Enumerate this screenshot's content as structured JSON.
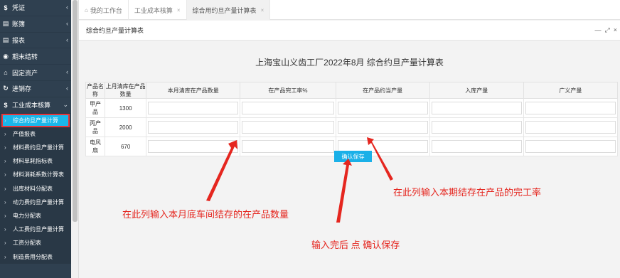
{
  "sidebar": {
    "items": [
      {
        "icon": "$",
        "label": "凭证",
        "chev": "‹"
      },
      {
        "icon": "▤",
        "label": "账簿",
        "chev": "‹"
      },
      {
        "icon": "▤",
        "label": "报表",
        "chev": "‹"
      },
      {
        "icon": "◉",
        "label": "期末结转",
        "chev": ""
      },
      {
        "icon": "⌂",
        "label": "固定资产",
        "chev": "‹"
      },
      {
        "icon": "↻",
        "label": "进销存",
        "chev": "‹"
      },
      {
        "icon": "$",
        "label": "工业成本核算",
        "chev": "⌄"
      }
    ],
    "subitems": [
      {
        "label": "综合约旦产量计算",
        "active": true
      },
      {
        "label": "产值报表"
      },
      {
        "label": "材料费约旦产量计算"
      },
      {
        "label": "材料单耗指标表"
      },
      {
        "label": "材料消耗系数计算表"
      },
      {
        "label": "出库材料分配表"
      },
      {
        "label": "动力费约旦产量计算"
      },
      {
        "label": "电力分配表"
      },
      {
        "label": "人工费约旦产量计算"
      },
      {
        "label": "工资分配表"
      },
      {
        "label": "制造费用分配表"
      }
    ]
  },
  "tabs": [
    {
      "label": "我的工作台",
      "home": true,
      "close": ""
    },
    {
      "label": "工业成本核算",
      "close": "×"
    },
    {
      "label": "综合用约旦产量计算表",
      "close": "×",
      "active": true
    }
  ],
  "panel": {
    "title": "综合约旦产量计算表",
    "tools": [
      "—",
      "⤢",
      "×"
    ]
  },
  "report": {
    "title": "上海宝山义齿工厂2022年8月 综合约旦产量计算表",
    "columns": [
      "产品名称",
      "上月清库在产品数量",
      "本月清库在产品数量",
      "在产品完工率%",
      "在产品约当产量",
      "入库产量",
      "广义产量"
    ],
    "rows": [
      {
        "name": "甲产品",
        "last_month": "1300"
      },
      {
        "name": "丙产品",
        "last_month": "2000"
      },
      {
        "name": "电风扇",
        "last_month": "670"
      }
    ],
    "save_label": "确认保存"
  },
  "annotations": {
    "left": "在此列输入本月底车间结存的在产品数量",
    "bottom": "输入完后  点 确认保存",
    "right": "在此列输入本期结存在产品的完工率"
  },
  "colors": {
    "accent": "#1ab0e8",
    "sidebar": "#2f4050",
    "annotation": "#e5261f"
  }
}
